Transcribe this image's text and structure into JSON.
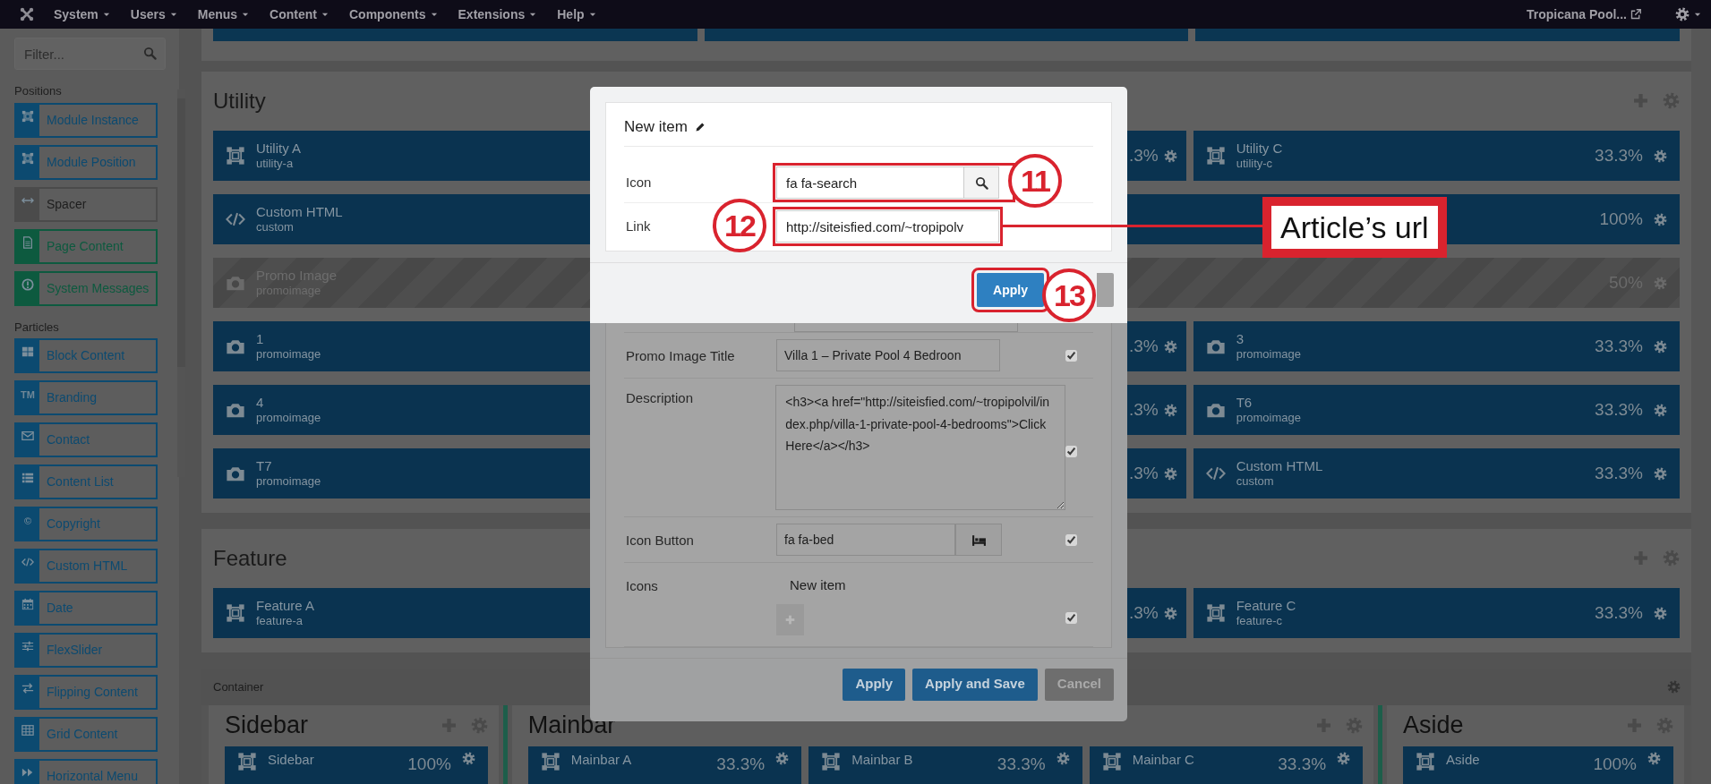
{
  "navbar": {
    "menus": [
      "System",
      "Users",
      "Menus",
      "Content",
      "Components",
      "Extensions",
      "Help"
    ],
    "site": "Tropicana Pool..."
  },
  "sidebar": {
    "filter_placeholder": "Filter...",
    "groups": [
      {
        "title": "Positions",
        "items": [
          {
            "label": "Module Instance",
            "color": "#0c4a70"
          },
          {
            "label": "Module Position",
            "color": "#0c4a70"
          },
          {
            "label": "Spacer",
            "color": "#4b4b4b"
          },
          {
            "label": "Page Content",
            "color": "#0d5a3f"
          },
          {
            "label": "System Messages",
            "color": "#0d5a3f"
          }
        ]
      },
      {
        "title": "Particles",
        "items": [
          {
            "label": "Block Content",
            "color": "#0c4a70"
          },
          {
            "label": "Branding",
            "color": "#0c4a70",
            "icon_text": "TM"
          },
          {
            "label": "Contact",
            "color": "#0c4a70"
          },
          {
            "label": "Content List",
            "color": "#0c4a70"
          },
          {
            "label": "Copyright",
            "color": "#0c4a70",
            "icon_text": "©"
          },
          {
            "label": "Custom HTML",
            "color": "#0c4a70"
          },
          {
            "label": "Date",
            "color": "#0c4a70"
          },
          {
            "label": "FlexSlider",
            "color": "#0c4a70"
          },
          {
            "label": "Flipping Content",
            "color": "#0c4a70"
          },
          {
            "label": "Grid Content",
            "color": "#0c4a70"
          },
          {
            "label": "Horizontal Menu",
            "color": "#0c4a70"
          }
        ]
      }
    ]
  },
  "sections": [
    {
      "title": "Utility",
      "rows": [
        [
          {
            "kind": "position",
            "title": "Utility A",
            "subtitle": "utility-a",
            "disabled": false
          },
          {
            "percent": ".3%",
            "disabled": false
          },
          {
            "kind": "position",
            "title": "Utility C",
            "subtitle": "utility-c",
            "percent": "33.3%",
            "disabled": false
          }
        ],
        [
          {
            "kind": "html",
            "title": "Custom HTML",
            "subtitle": "custom",
            "percent": "100%",
            "disabled": false
          }
        ],
        [
          {
            "kind": "image",
            "title": "Promo Image",
            "subtitle": "promoimage",
            "percent": "50%",
            "disabled": true
          }
        ],
        [
          {
            "kind": "image",
            "title": "1",
            "subtitle": "promoimage",
            "disabled": false
          },
          {
            "percent": ".3%",
            "disabled": false
          },
          {
            "kind": "image",
            "title": "3",
            "subtitle": "promoimage",
            "percent": "33.3%",
            "disabled": false
          }
        ],
        [
          {
            "kind": "image",
            "title": "4",
            "subtitle": "promoimage",
            "disabled": false
          },
          {
            "percent": ".3%",
            "disabled": false
          },
          {
            "kind": "image",
            "title": "T6",
            "subtitle": "promoimage",
            "percent": "33.3%",
            "disabled": false
          }
        ],
        [
          {
            "kind": "image",
            "title": "T7",
            "subtitle": "promoimage",
            "disabled": false
          },
          {
            "percent": ".3%",
            "disabled": false
          },
          {
            "kind": "html",
            "title": "Custom HTML",
            "subtitle": "custom",
            "percent": "33.3%",
            "disabled": false
          }
        ]
      ]
    },
    {
      "title": "Feature",
      "rows": [
        [
          {
            "kind": "position",
            "title": "Feature A",
            "subtitle": "feature-a",
            "disabled": false
          },
          {
            "percent": ".3%",
            "disabled": false
          },
          {
            "kind": "position",
            "title": "Feature C",
            "subtitle": "feature-c",
            "percent": "33.3%",
            "disabled": false
          }
        ]
      ]
    }
  ],
  "container": {
    "label": "Container",
    "columns": [
      {
        "title": "Sidebar",
        "blocks": [
          {
            "kind": "position",
            "title": "Sidebar",
            "percent": "100%",
            "disabled": false
          }
        ]
      },
      {
        "title": "Mainbar",
        "blocks": [
          {
            "kind": "position",
            "title": "Mainbar A",
            "percent": "33.3%",
            "disabled": false
          },
          {
            "kind": "position",
            "title": "Mainbar B",
            "percent": "33.3%",
            "disabled": false
          },
          {
            "kind": "position",
            "title": "Mainbar C",
            "percent": "33.3%",
            "disabled": false
          }
        ]
      },
      {
        "title": "Aside",
        "blocks": [
          {
            "kind": "position",
            "title": "Aside",
            "percent": "100%",
            "disabled": false
          }
        ]
      }
    ]
  },
  "item_modal": {
    "title": "New item",
    "fields": [
      {
        "label": "Icon",
        "kind": "icon",
        "value": "fa fa-search"
      },
      {
        "label": "Link",
        "kind": "text",
        "value": "http://siteisfied.com/~tropipolv"
      }
    ],
    "buttons": [
      {
        "label": "Apply",
        "kind": "primary"
      },
      {
        "kind": "secondary"
      }
    ]
  },
  "editor_modal": {
    "fields": [
      {
        "kind": "cut"
      },
      {
        "label": "Promo Image Title",
        "kind": "text",
        "value": "Villa 1 – Private Pool 4 Bedroon",
        "checked": true
      },
      {
        "label": "Description",
        "kind": "textarea",
        "value": "<h3><a href=\"http://siteisfied.com/~tropipolvil/index.php/villa-1-private-pool-4-bedrooms\">Click Here</a></h3>",
        "checked": true
      },
      {
        "label": "Icon Button",
        "kind": "icon",
        "value": "fa fa-bed",
        "checked": true
      },
      {
        "label": "Icons",
        "kind": "list",
        "items": [
          "New item"
        ],
        "checked": true
      }
    ],
    "buttons": [
      {
        "label": "Apply",
        "kind": "primary"
      },
      {
        "label": "Apply and Save",
        "kind": "primary"
      },
      {
        "label": "Cancel",
        "kind": "secondary"
      }
    ]
  },
  "annotations": {
    "callouts": [
      "11",
      "12",
      "13"
    ],
    "label": "Article’s url"
  }
}
